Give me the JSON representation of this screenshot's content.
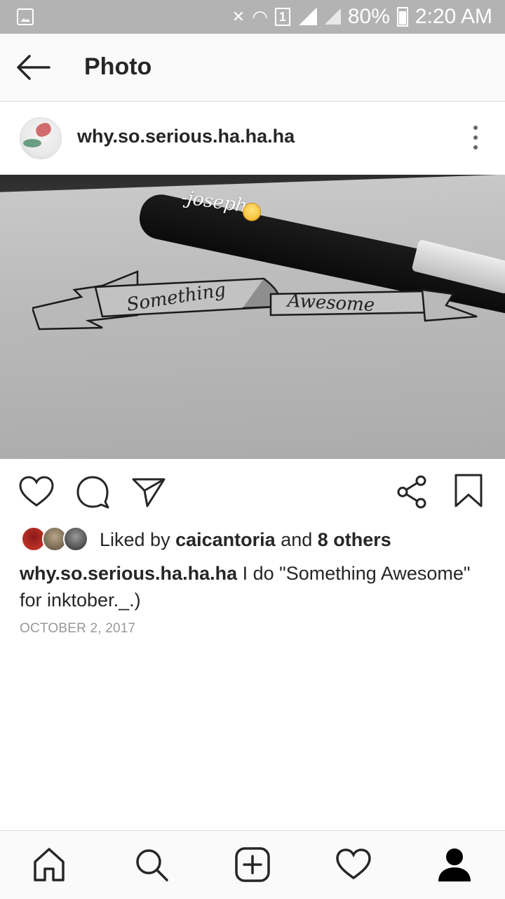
{
  "status_bar": {
    "sim_slot": "1",
    "battery": "80%",
    "time": "2:20 AM"
  },
  "header": {
    "title": "Photo",
    "back_icon": "arrow-left-icon"
  },
  "post": {
    "username": "why.so.serious.ha.ha.ha",
    "photo_watermark": "-joseph",
    "photo_banner_text_1": "Something",
    "photo_banner_text_2": "Awesome",
    "likes": {
      "prefix": "Liked by",
      "first_liker": "caicantoria",
      "connector": "and",
      "others": "8 others"
    },
    "caption": {
      "username": "why.so.serious.ha.ha.ha",
      "text": "I do \"Something Awesome\" for inktober._.)"
    },
    "date": "OCTOBER 2, 2017"
  },
  "actions": {
    "icons": [
      "heart-icon",
      "comment-icon",
      "send-icon",
      "share-icon",
      "bookmark-icon"
    ]
  },
  "bottom_nav": {
    "icons": [
      "home-icon",
      "search-icon",
      "add-icon",
      "activity-heart-icon",
      "profile-icon"
    ]
  },
  "colors": {
    "text": "#262626",
    "secondary_text": "#999999",
    "status_bar": "#b3b3b3",
    "bar_background": "#fafafa",
    "divider": "#dbdbdb"
  }
}
